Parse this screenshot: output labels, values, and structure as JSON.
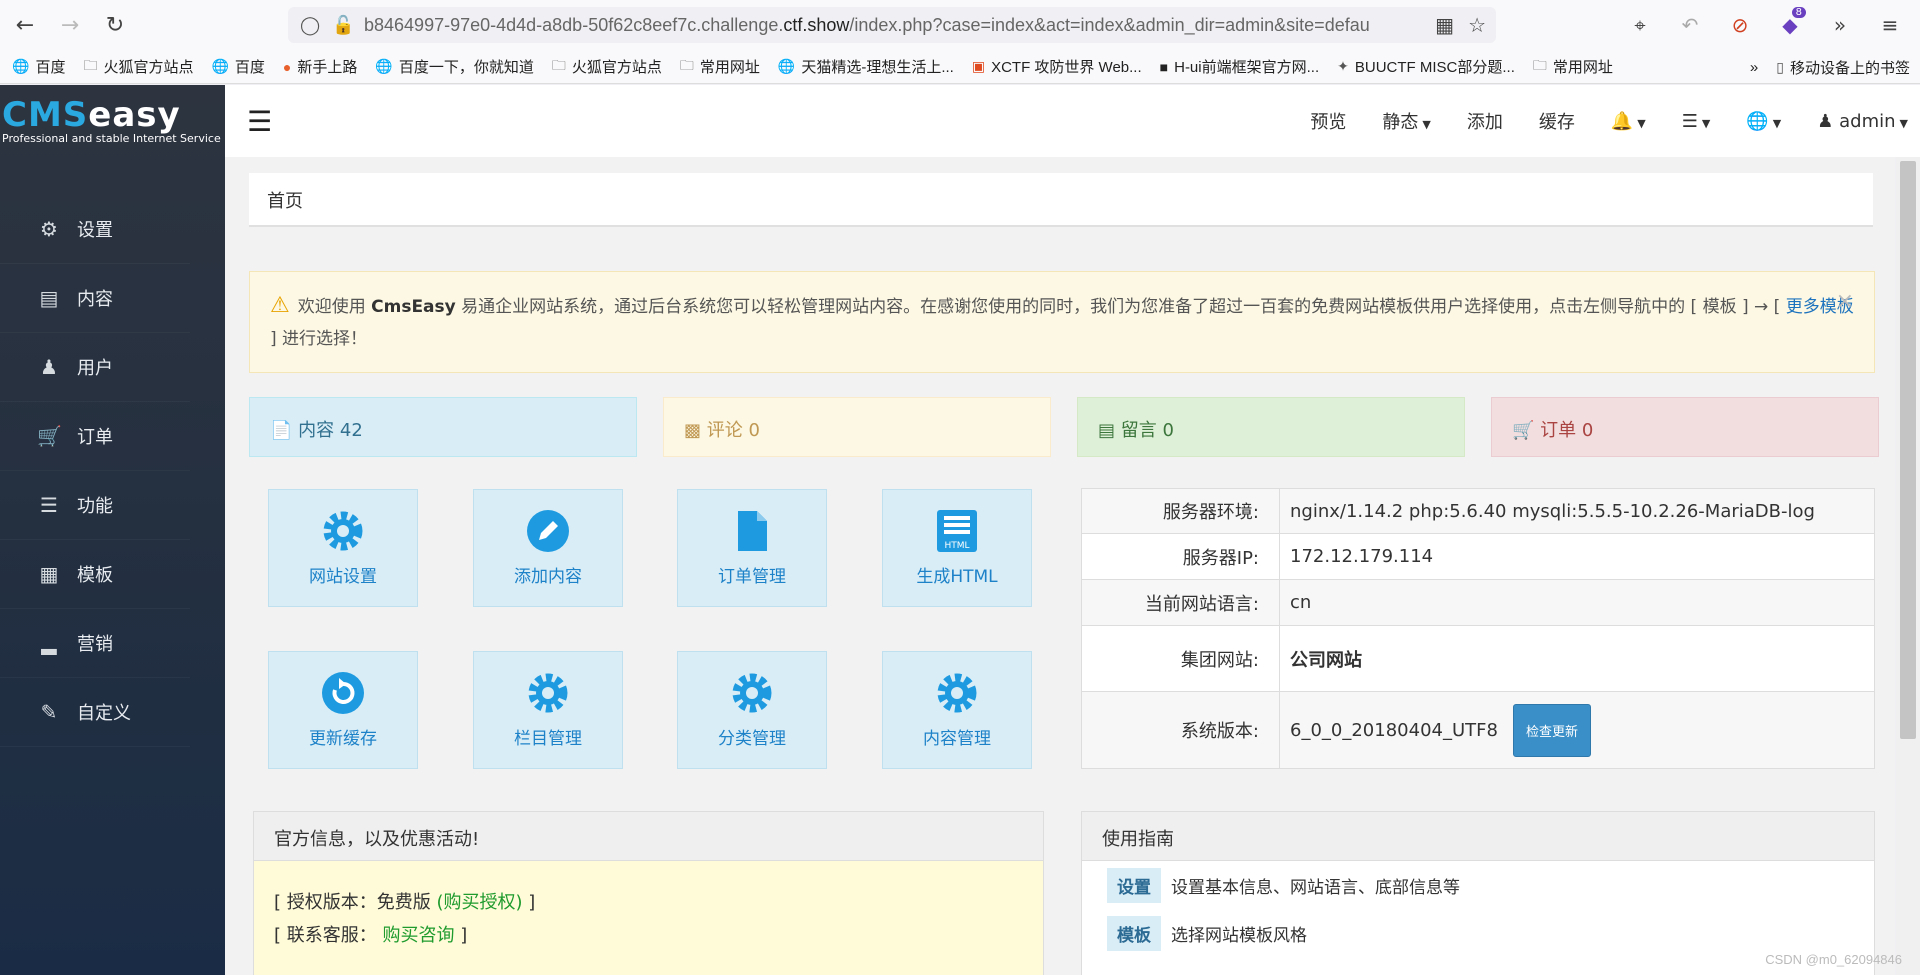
{
  "browser": {
    "url_prefix": "b8464997-97e0-4d4d-a8db-50f62c8eef7c.challenge.",
    "url_domain": "ctf.show",
    "url_path": "/index.php?case=index&act=index&admin_dir=admin&site=defau",
    "extensions_badge": "8",
    "bookmarks": [
      "百度",
      "火狐官方站点",
      "百度",
      "新手上路",
      "百度一下，你就知道",
      "火狐官方站点",
      "常用网址",
      "天猫精选-理想生活上...",
      "XCTF 攻防世界 Web...",
      "H-ui前端框架官方网...",
      "BUUCTF MISC部分题...",
      "常用网址"
    ],
    "mobile_bookmarks": "移动设备上的书签"
  },
  "logo": {
    "part1": "CMS",
    "part2": "easy",
    "tagline": "Professional and stable Internet Service"
  },
  "sidebar": {
    "items": [
      {
        "label": "设置",
        "icon": "gear-icon"
      },
      {
        "label": "内容",
        "icon": "list-icon"
      },
      {
        "label": "用户",
        "icon": "user-icon"
      },
      {
        "label": "订单",
        "icon": "cart-icon"
      },
      {
        "label": "功能",
        "icon": "list-ul-icon"
      },
      {
        "label": "模板",
        "icon": "grid-icon"
      },
      {
        "label": "营销",
        "icon": "signal-icon"
      },
      {
        "label": "自定义",
        "icon": "edit-icon"
      }
    ]
  },
  "topnav": {
    "preview": "预览",
    "static": "静态",
    "add": "添加",
    "cache": "缓存",
    "user": "admin"
  },
  "breadcrumb": "首页",
  "alert": {
    "p1": "欢迎使用 ",
    "brand": "CmsEasy",
    "p2": " 易通企业网站系统，通过后台系统您可以轻松管理网站内容。在感谢您使用的同时，我们为您准备了超过一百套的免费网站模板供用户选择使用，点击左侧导航中的 [ 模板 ] → [ ",
    "link": "更多模板",
    "p3": " ] 进行选择！"
  },
  "stats": [
    {
      "label": "内容 42",
      "icon": "file-icon"
    },
    {
      "label": "评论 0",
      "icon": "comment-icon"
    },
    {
      "label": "留言 0",
      "icon": "list-alt-icon"
    },
    {
      "label": "订单 0",
      "icon": "cart-icon"
    }
  ],
  "tiles": [
    {
      "label": "网站设置",
      "icon": "gear-icon"
    },
    {
      "label": "添加内容",
      "icon": "pencil-circle-icon"
    },
    {
      "label": "订单管理",
      "icon": "file-icon"
    },
    {
      "label": "生成HTML",
      "icon": "html-icon"
    },
    {
      "label": "更新缓存",
      "icon": "refresh-circle-icon"
    },
    {
      "label": "栏目管理",
      "icon": "gear-icon"
    },
    {
      "label": "分类管理",
      "icon": "gear-icon"
    },
    {
      "label": "内容管理",
      "icon": "gear-icon"
    }
  ],
  "server_info": {
    "env_label": "服务器环境:",
    "env_value": "nginx/1.14.2 php:5.6.40 mysqli:5.5.5-10.2.26-MariaDB-log",
    "ip_label": "服务器IP:",
    "ip_value": "172.12.179.114",
    "lang_label": "当前网站语言:",
    "lang_value": "cn",
    "group_label": "集团网站:",
    "group_value": "公司网站",
    "ver_label": "系统版本:",
    "ver_value": "6_0_0_20180404_UTF8",
    "check_update": "检查更新"
  },
  "official_panel": {
    "title": "官方信息，以及优惠活动!",
    "license_label": "[ 授权版本：免费版 ",
    "license_link": "(购买授权)",
    "license_end": " ]",
    "support_label": "[ 联系客服：  ",
    "support_link": "购买咨询",
    "support_end": " ]"
  },
  "guide_panel": {
    "title": "使用指南",
    "rows": [
      {
        "tag": "设置",
        "text": "设置基本信息、网站语言、底部信息等"
      },
      {
        "tag": "模板",
        "text": "选择网站模板风格"
      }
    ]
  },
  "watermark": "CSDN @m0_62094846",
  "colors": {
    "sidebar_bg": "#253040",
    "tile_bg": "#d9edf7",
    "tile_icon": "#1e9be0",
    "check_btn": "#3a8fc8"
  }
}
